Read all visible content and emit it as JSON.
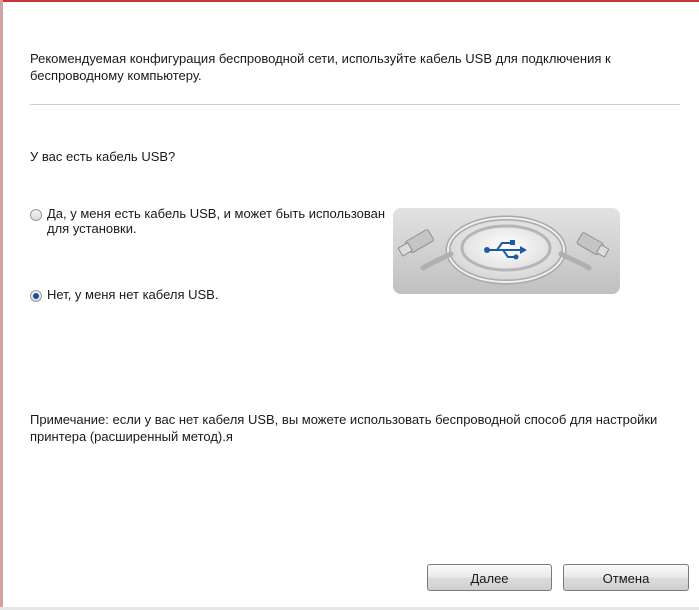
{
  "intro": "Рекомендуемая конфигурация беспроводной сети, используйте кабель USB для подключения к беспроводному компьютеру.",
  "question": "У вас есть кабель USB?",
  "options": [
    {
      "label": "Да, у меня есть кабель USB, и может быть использован для установки.",
      "selected": false
    },
    {
      "label": "Нет, у меня нет кабеля USB.",
      "selected": true
    }
  ],
  "note": "Примечание: если у вас нет кабеля USB, вы можете использовать беспроводной способ для настройки принтера (расширенный метод).я",
  "buttons": {
    "next": "Далее",
    "cancel": "Отмена"
  },
  "illustration": {
    "icon": "usb-cable-icon"
  },
  "colors": {
    "window_edge": "#c9323a",
    "radio_selected": "#1d4e9c"
  }
}
